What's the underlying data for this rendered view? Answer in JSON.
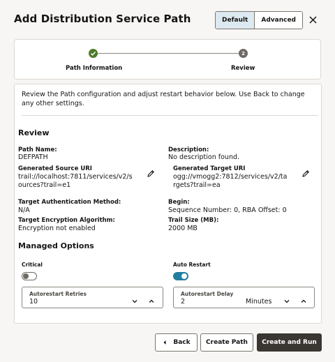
{
  "dialog": {
    "title": "Add Distribution Service Path",
    "mode_default": "Default",
    "mode_advanced": "Advanced",
    "close_icon": "close-icon"
  },
  "train": {
    "step1": "Path Information",
    "step2": "Review",
    "step2_number": "2"
  },
  "intro": "Review the Path configuration and adjust restart behavior below. Use Back to change any other settings.",
  "review": {
    "heading": "Review",
    "path_name_label": "Path Name:",
    "path_name": "DEFPATH",
    "description_label": "Description:",
    "description": "No description found.",
    "source_uri_label": "Generated Source URI",
    "source_uri_line1": "trail://localhost:7811/services/v2/s",
    "source_uri_line2": "ources?trail=e1",
    "target_uri_label": "Generated Target URI",
    "target_uri_line1": "ogg://vmogg2:7812/services/v2/ta",
    "target_uri_line2": "rgets?trail=ea",
    "target_auth_label": "Target Authentication Method:",
    "target_auth": "N/A",
    "begin_label": "Begin:",
    "begin": "Sequence Number: 0, RBA Offset: 0",
    "target_enc_label": "Target Encryption Algorithm:",
    "target_enc": "Encryption not enabled",
    "trail_size_label": "Trail Size (MB):",
    "trail_size": "2000 MB"
  },
  "managed": {
    "heading": "Managed Options",
    "critical_label": "Critical",
    "critical_on": false,
    "auto_restart_label": "Auto Restart",
    "auto_restart_on": true,
    "retries_label": "Autorestart Retries",
    "retries_value": "10",
    "delay_label": "Autorestart Delay",
    "delay_value": "2",
    "delay_unit": "Minutes"
  },
  "footer": {
    "back": "Back",
    "create": "Create Path",
    "create_run": "Create and Run"
  },
  "colors": {
    "accent": "#227e9e",
    "success": "#4d7b28",
    "primary_button": "#3a3632"
  }
}
